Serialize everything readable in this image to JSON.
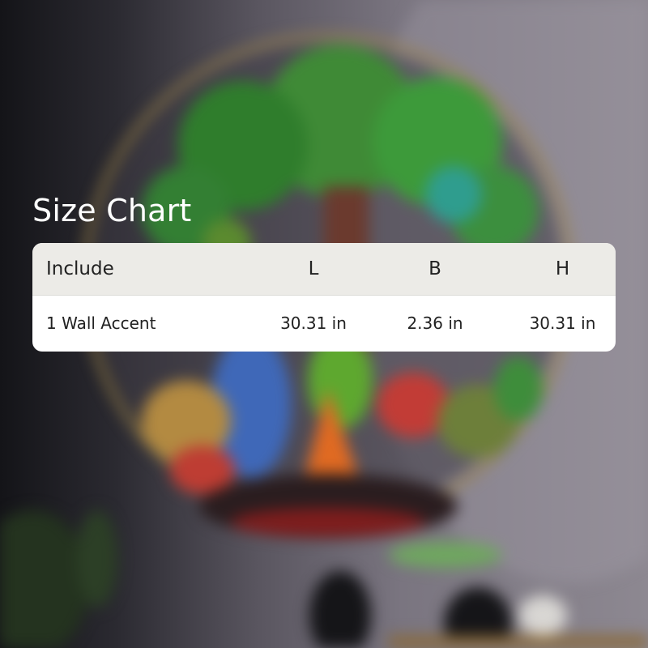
{
  "title": "Size Chart",
  "table": {
    "headers": [
      "Include",
      "L",
      "B",
      "H"
    ],
    "rows": [
      [
        "1 Wall Accent",
        "30.31 in",
        "2.36 in",
        "30.31 in"
      ]
    ]
  },
  "colors": {
    "header_bg": "#ecebe7",
    "card_bg": "#ffffff",
    "title_text": "#ffffff",
    "body_text": "#222222"
  }
}
